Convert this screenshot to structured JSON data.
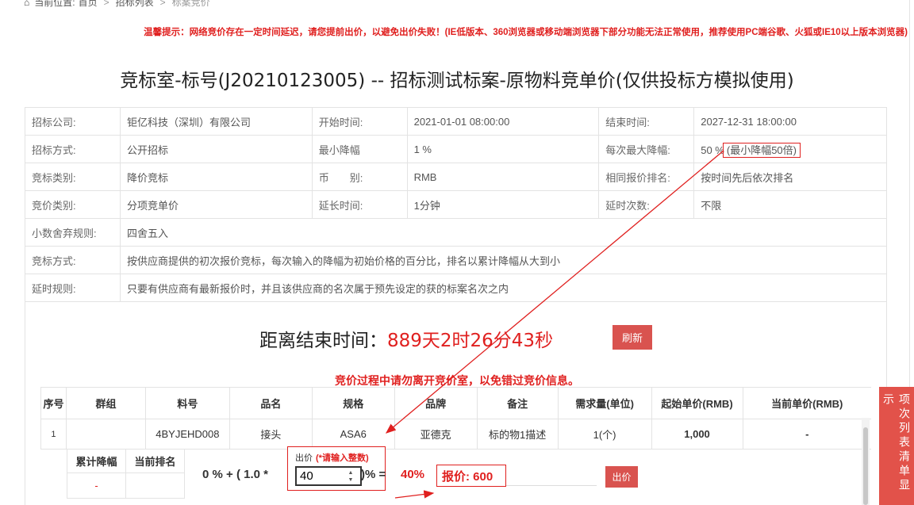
{
  "breadcrumb": {
    "prefix": "当前位置:",
    "home": "首页",
    "list": "招标列表",
    "current": "标案竞价"
  },
  "notice": "温馨提示：网络竞价存在一定时间延迟，请您提前出价，以避免出价失败！(IE低版本、360浏览器或移动端浏览器下部分功能无法正常使用，推荐使用PC端谷歌、火狐或IE10以上版本浏览器)",
  "title": "竞标室-标号(J20210123005) -- 招标测试标案-原物料竞单价(仅供投标方模拟使用)",
  "info": {
    "r1": [
      "招标公司:",
      "钜亿科技（深圳）有限公司",
      "开始时间:",
      "2021-01-01 08:00:00",
      "结束时间:",
      "2027-12-31 18:00:00"
    ],
    "r2": [
      "招标方式:",
      "公开招标",
      "最小降幅",
      "1 %",
      "每次最大降幅:",
      "50 %",
      "(最小降幅50倍)"
    ],
    "r3": [
      "竞标类别:",
      "降价竞标",
      "币　　别:",
      "RMB",
      "相同报价排名:",
      "按时间先后依次排名"
    ],
    "r4": [
      "竞价类别:",
      "分项竞单价",
      "延长时间:",
      "1分钟",
      "延时次数:",
      "不限"
    ],
    "r5": [
      "小数舍弃规则:",
      "四舍五入"
    ],
    "r6": [
      "竞标方式:",
      "按供应商提供的初次报价竞标，每次输入的降幅为初始价格的百分比，排名以累计降幅从大到小"
    ],
    "r7": [
      "延时规则:",
      "只要有供应商有最新报价时，并且该供应商的名次属于预先设定的获的标案名次之内"
    ]
  },
  "countdown": {
    "label": "距离结束时间：",
    "time": "889天2时26分43秒"
  },
  "refresh_label": "刷新",
  "warning": "竞价过程中请勿离开竞价室，以免错过竞价信息。",
  "items": {
    "headers": [
      "序号",
      "群组",
      "料号",
      "品名",
      "规格",
      "品牌",
      "备注",
      "需求量(单位)",
      "起始单价(RMB)",
      "当前单价(RMB)"
    ],
    "row": [
      "1",
      "",
      "4BYJEHD008",
      "接头",
      "ASA6",
      "亚德克",
      "标的物1描述",
      "1(个)",
      "1,000",
      "-"
    ]
  },
  "sub": {
    "headers": [
      "累计降幅",
      "当前排名"
    ],
    "values": [
      "-",
      ""
    ]
  },
  "formula": {
    "prefix": "0 % + ( 1.0 *",
    "bid_label": "出价",
    "bid_required": "(*请输入整数)",
    "bid_value": "40",
    "suffix": ")% =",
    "result_pct": "40%",
    "quote": "报价: 600",
    "bid_button": "出价"
  },
  "side_tab": "项次列表清单显示",
  "colors": {
    "accent_red": "#e0201f",
    "button_red": "#d9534f"
  }
}
